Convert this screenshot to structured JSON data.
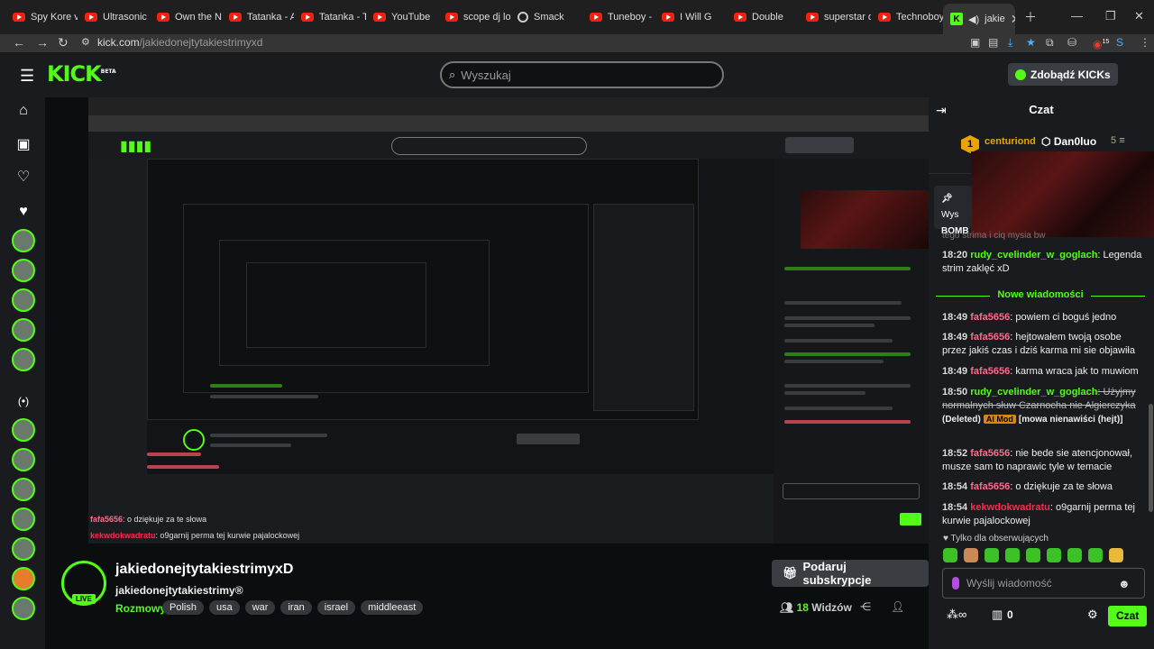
{
  "browser": {
    "tabs": [
      {
        "label": "Spy Kore vs"
      },
      {
        "label": "Ultrasonic -"
      },
      {
        "label": "Own the Ni"
      },
      {
        "label": "Tatanka - Af"
      },
      {
        "label": "Tatanka - Ta"
      },
      {
        "label": "YouTube"
      },
      {
        "label": "scope dj loc"
      },
      {
        "label": "Smack"
      },
      {
        "label": "Tuneboy - V"
      },
      {
        "label": "I Will G"
      },
      {
        "label": "Double"
      },
      {
        "label": "superstar dj"
      },
      {
        "label": "Technoboy"
      },
      {
        "label": "jakie"
      }
    ],
    "url_host": "kick.com",
    "url_path": "/jakiedonejtytakiestrimyxd",
    "extension_badge": "15"
  },
  "header": {
    "logo": "KICK",
    "logo_badge": "BETA",
    "search_placeholder": "Wyszukaj",
    "get_kicks": "Zdobądź KICKs"
  },
  "stream": {
    "title": "jakiedonejtytakiestrimyxD",
    "username": "jakiedonejtytakiestrimy®",
    "category": "Rozmowy",
    "tags": [
      "Polish",
      "usa",
      "war",
      "iran",
      "israel",
      "middleeast"
    ],
    "subscribe": "Podaruj subskrypcje",
    "viewers": "18",
    "viewers_label": "Widzów",
    "live": "LIVE"
  },
  "video_overlay": {
    "line1_user": "fafa5656",
    "line1_text": ": o dziękuje za te słowa",
    "line2_user": "kekwdokwadratu",
    "line2_text": ": o9garnij perma tej kurwie pajalockowej"
  },
  "chat": {
    "title": "Czat",
    "pinned_user": "centuriond",
    "pinned_user2": "Dan0luo",
    "pinned_count": "5",
    "pinned_rank": "1",
    "pinned_card_icon": "Wys",
    "pinned_card_label": "BOMB",
    "partial_text": "tego strima i ciq mysia bw",
    "new_messages": "Nowe wiadomości",
    "messages": [
      {
        "time": "18:20",
        "user": "rudy_cvelinder_w_goglach",
        "color": "#53fc18",
        "text": ": Legenda strim zaklęć xD"
      },
      {
        "time": "18:49",
        "user": "fafa5656",
        "color": "#ff6b8a",
        "text": ": powiem ci boguś jedno"
      },
      {
        "time": "18:49",
        "user": "fafa5656",
        "color": "#ff6b8a",
        "text": ": hejtowałem twoją osobe przez jakiś czas i dziś karma mi sie objawiła"
      },
      {
        "time": "18:49",
        "user": "fafa5656",
        "color": "#ff6b8a",
        "text": ": karma wraca jak to muwiom"
      },
      {
        "time": "18:50",
        "user": "rudy_cvelinder_w_goglach",
        "color": "#53fc18",
        "text": ": Użyjmy normalnych słuw Czarnocha nie Algierczyka",
        "deleted": "(Deleted)",
        "mod": "AI Mod",
        "note": "[mowa nienawiści (hejt)]"
      },
      {
        "time": "18:52",
        "user": "fafa5656",
        "color": "#ff6b8a",
        "text": ": nie bede sie atencjonował, musze sam to naprawic tyle w temacie"
      },
      {
        "time": "18:54",
        "user": "fafa5656",
        "color": "#ff6b8a",
        "text": ": o dziękuje za te słowa"
      },
      {
        "time": "18:54",
        "user": "kekwdokwadratu",
        "color": "#ff2a4d",
        "text": ": o9garnij perma tej kurwie pajalockowej"
      }
    ],
    "followers_only": "Tylko dla obserwujących",
    "input_placeholder": "Wyślij wiadomość",
    "points": "0",
    "send": "Czat"
  }
}
